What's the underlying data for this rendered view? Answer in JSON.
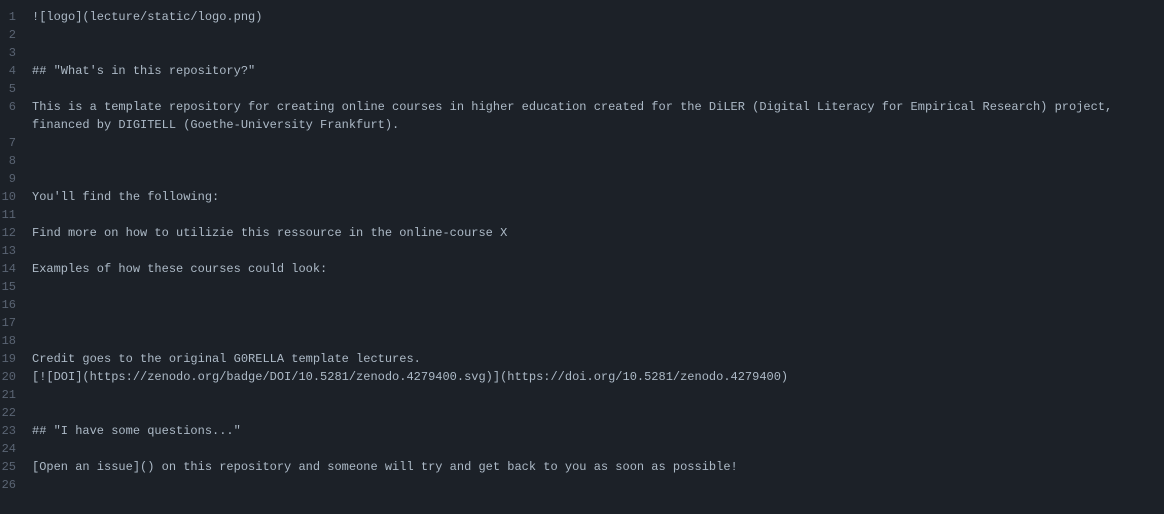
{
  "lines": [
    {
      "num": "1",
      "content": "![logo](lecture/static/logo.png)"
    },
    {
      "num": "2",
      "content": ""
    },
    {
      "num": "3",
      "content": ""
    },
    {
      "num": "4",
      "content": "## \"What's in this repository?\""
    },
    {
      "num": "5",
      "content": ""
    },
    {
      "num": "6",
      "content": "This is a template repository for creating online courses in higher education created for the DiLER (Digital Literacy for Empirical Research) project, financed by DIGITELL (Goethe-University Frankfurt)."
    },
    {
      "num": "7",
      "content": ""
    },
    {
      "num": "8",
      "content": ""
    },
    {
      "num": "9",
      "content": ""
    },
    {
      "num": "10",
      "content": "You'll find the following:"
    },
    {
      "num": "11",
      "content": ""
    },
    {
      "num": "12",
      "content": "Find more on how to utilizie this ressource in the online-course X"
    },
    {
      "num": "13",
      "content": ""
    },
    {
      "num": "14",
      "content": "Examples of how these courses could look:"
    },
    {
      "num": "15",
      "content": ""
    },
    {
      "num": "16",
      "content": ""
    },
    {
      "num": "17",
      "content": ""
    },
    {
      "num": "18",
      "content": ""
    },
    {
      "num": "19",
      "content": "Credit goes to the original G0RELLA template lectures."
    },
    {
      "num": "20",
      "content": "[![DOI](https://zenodo.org/badge/DOI/10.5281/zenodo.4279400.svg)](https://doi.org/10.5281/zenodo.4279400)"
    },
    {
      "num": "21",
      "content": ""
    },
    {
      "num": "22",
      "content": ""
    },
    {
      "num": "23",
      "content": "## \"I have some questions...\""
    },
    {
      "num": "24",
      "content": ""
    },
    {
      "num": "25",
      "content": "[Open an issue]() on this repository and someone will try and get back to you as soon as possible!"
    },
    {
      "num": "26",
      "content": ""
    }
  ]
}
